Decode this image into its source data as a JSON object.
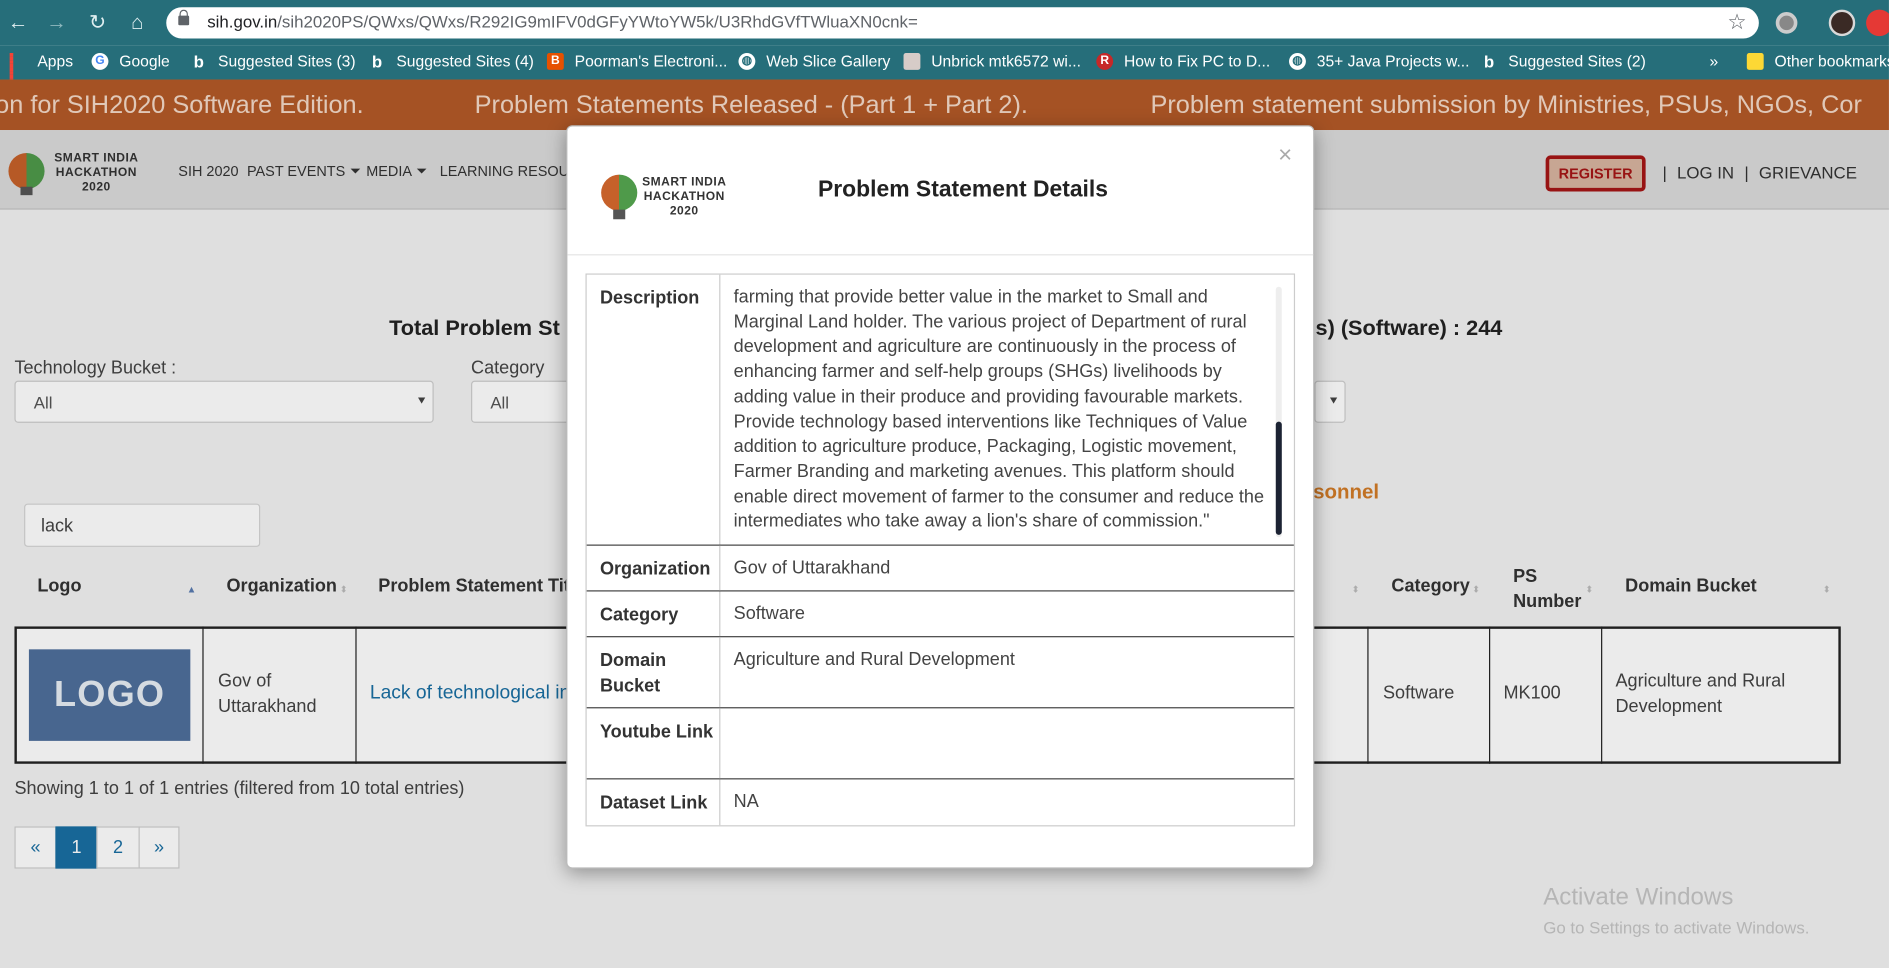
{
  "browser": {
    "url_host": "sih.gov.in",
    "url_path": "/sih2020PS/QWxs/QWxs/R292IG9mIFV0dGFyYWtoYW5k/U3RhdGVfTWluaXN0cnk=",
    "bookmarks": [
      "Apps",
      "Google",
      "Suggested Sites (3)",
      "Suggested Sites (4)",
      "Poorman's Electroni...",
      "Web Slice Gallery",
      "Unbrick mtk6572 wi...",
      "How to Fix PC to D...",
      "35+ Java Projects w...",
      "Suggested Sites (2)",
      "»",
      "Other bookmarks"
    ]
  },
  "ticker": [
    "on for SIH2020 Software Edition.",
    "Problem Statements Released - (Part 1 + Part 2).",
    "Problem statement submission by Ministries, PSUs, NGOs, Cor"
  ],
  "header": {
    "logo_lines": [
      "SMART INDIA",
      "HACKATHON",
      "2020"
    ],
    "nav": [
      "SIH 2020",
      "PAST EVENTS",
      "MEDIA",
      "LEARNING RESOURC"
    ],
    "register": "REGISTER",
    "sep": "|",
    "login": "LOG IN",
    "grievance": "GRIEVANCE"
  },
  "main": {
    "title_left": "Total Problem St",
    "title_right": "s) (Software) : 244",
    "filter_tech_label": "Technology Bucket :",
    "filter_tech_value": "All",
    "filter_cat_label": "Category",
    "filter_cat_value": "All",
    "orange_text": "sonnel",
    "search_value": "lack",
    "columns": [
      "Logo",
      "Organization",
      "Problem Statement Tit",
      "Category",
      "PS Number",
      "Domain Bucket"
    ],
    "row": {
      "logo": "LOGO",
      "organization": "Gov of Uttarakhand",
      "title": "Lack of technological in",
      "category": "Software",
      "ps_number": "MK100",
      "domain": "Agriculture and Rural Development"
    },
    "showing": "Showing 1 to 1 of 1 entries (filtered from 10 total entries)",
    "pages": [
      "«",
      "1",
      "2",
      "»"
    ]
  },
  "watermark": {
    "title": "Activate Windows",
    "subtitle": "Go to Settings to activate Windows."
  },
  "modal": {
    "logo_lines": [
      "SMART INDIA",
      "HACKATHON",
      "2020"
    ],
    "title": "Problem Statement Details",
    "close": "×",
    "rows": [
      {
        "key": "Description",
        "value": "farming that provide better value in the market to Small and Marginal Land holder. The various project of Department of rural development and agriculture are continuously in the process of enhancing farmer and self-help groups (SHGs) livelihoods by adding value in their produce and providing favourable markets. Provide technology based interventions like Techniques of Value addition to agriculture produce, Packaging, Logistic movement, Farmer Branding and marketing avenues. This platform should enable direct movement of farmer to the consumer and reduce the intermediates who take away a lion's share of commission.\""
      },
      {
        "key": "Organization",
        "value": "Gov of Uttarakhand"
      },
      {
        "key": "Category",
        "value": "Software"
      },
      {
        "key": "Domain Bucket",
        "value": "Agriculture and Rural Development"
      },
      {
        "key": "Youtube Link",
        "value": ""
      },
      {
        "key": "Dataset Link",
        "value": "NA"
      }
    ]
  }
}
